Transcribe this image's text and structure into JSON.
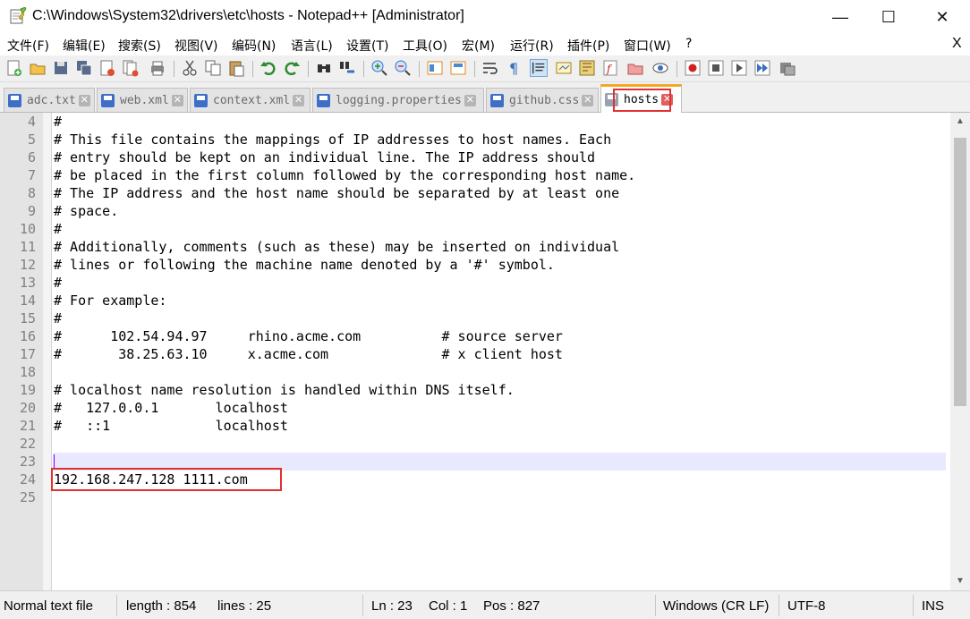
{
  "window": {
    "title": "C:\\Windows\\System32\\drivers\\etc\\hosts - Notepad++ [Administrator]",
    "min_symbol": "—",
    "max_symbol": "☐",
    "close_symbol": "✕"
  },
  "menu": {
    "items": [
      "文件(F)",
      "编辑(E)",
      "搜索(S)",
      "视图(V)",
      "编码(N)",
      "语言(L)",
      "设置(T)",
      "工具(O)",
      "宏(M)",
      "运行(R)",
      "插件(P)",
      "窗口(W)",
      "?"
    ],
    "close_doc": "X"
  },
  "tabs": [
    {
      "label": "adc.txt",
      "active": false
    },
    {
      "label": "web.xml",
      "active": false
    },
    {
      "label": "context.xml",
      "active": false
    },
    {
      "label": "logging.properties",
      "active": false
    },
    {
      "label": "github.css",
      "active": false
    },
    {
      "label": "hosts",
      "active": true
    }
  ],
  "tab_close_symbol": "✕",
  "editor": {
    "lines": [
      {
        "n": "4",
        "text": "#"
      },
      {
        "n": "5",
        "text": "# This file contains the mappings of IP addresses to host names. Each"
      },
      {
        "n": "6",
        "text": "# entry should be kept on an individual line. The IP address should"
      },
      {
        "n": "7",
        "text": "# be placed in the first column followed by the corresponding host name."
      },
      {
        "n": "8",
        "text": "# The IP address and the host name should be separated by at least one"
      },
      {
        "n": "9",
        "text": "# space."
      },
      {
        "n": "10",
        "text": "#"
      },
      {
        "n": "11",
        "text": "# Additionally, comments (such as these) may be inserted on individual"
      },
      {
        "n": "12",
        "text": "# lines or following the machine name denoted by a '#' symbol."
      },
      {
        "n": "13",
        "text": "#"
      },
      {
        "n": "14",
        "text": "# For example:"
      },
      {
        "n": "15",
        "text": "#"
      },
      {
        "n": "16",
        "text": "#      102.54.94.97     rhino.acme.com          # source server"
      },
      {
        "n": "17",
        "text": "#       38.25.63.10     x.acme.com              # x client host"
      },
      {
        "n": "18",
        "text": ""
      },
      {
        "n": "19",
        "text": "# localhost name resolution is handled within DNS itself."
      },
      {
        "n": "20",
        "text": "#   127.0.0.1       localhost"
      },
      {
        "n": "21",
        "text": "#   ::1             localhost"
      },
      {
        "n": "22",
        "text": ""
      },
      {
        "n": "23",
        "text": ""
      },
      {
        "n": "24",
        "text": "192.168.247.128 1111.com"
      },
      {
        "n": "25",
        "text": ""
      }
    ]
  },
  "scrollbar": {
    "up": "▲",
    "down": "▼"
  },
  "status": {
    "file_type": "Normal text file",
    "length": "length : 854",
    "lines": "lines : 25",
    "ln": "Ln : 23",
    "col": "Col : 1",
    "pos": "Pos : 827",
    "eol": "Windows (CR LF)",
    "encoding": "UTF-8",
    "mode": "INS"
  },
  "colors": {
    "accent_tab": "#f5a623",
    "highlight_box": "#e03030",
    "current_line": "#e8e8ff",
    "caret": "#8000ff"
  }
}
